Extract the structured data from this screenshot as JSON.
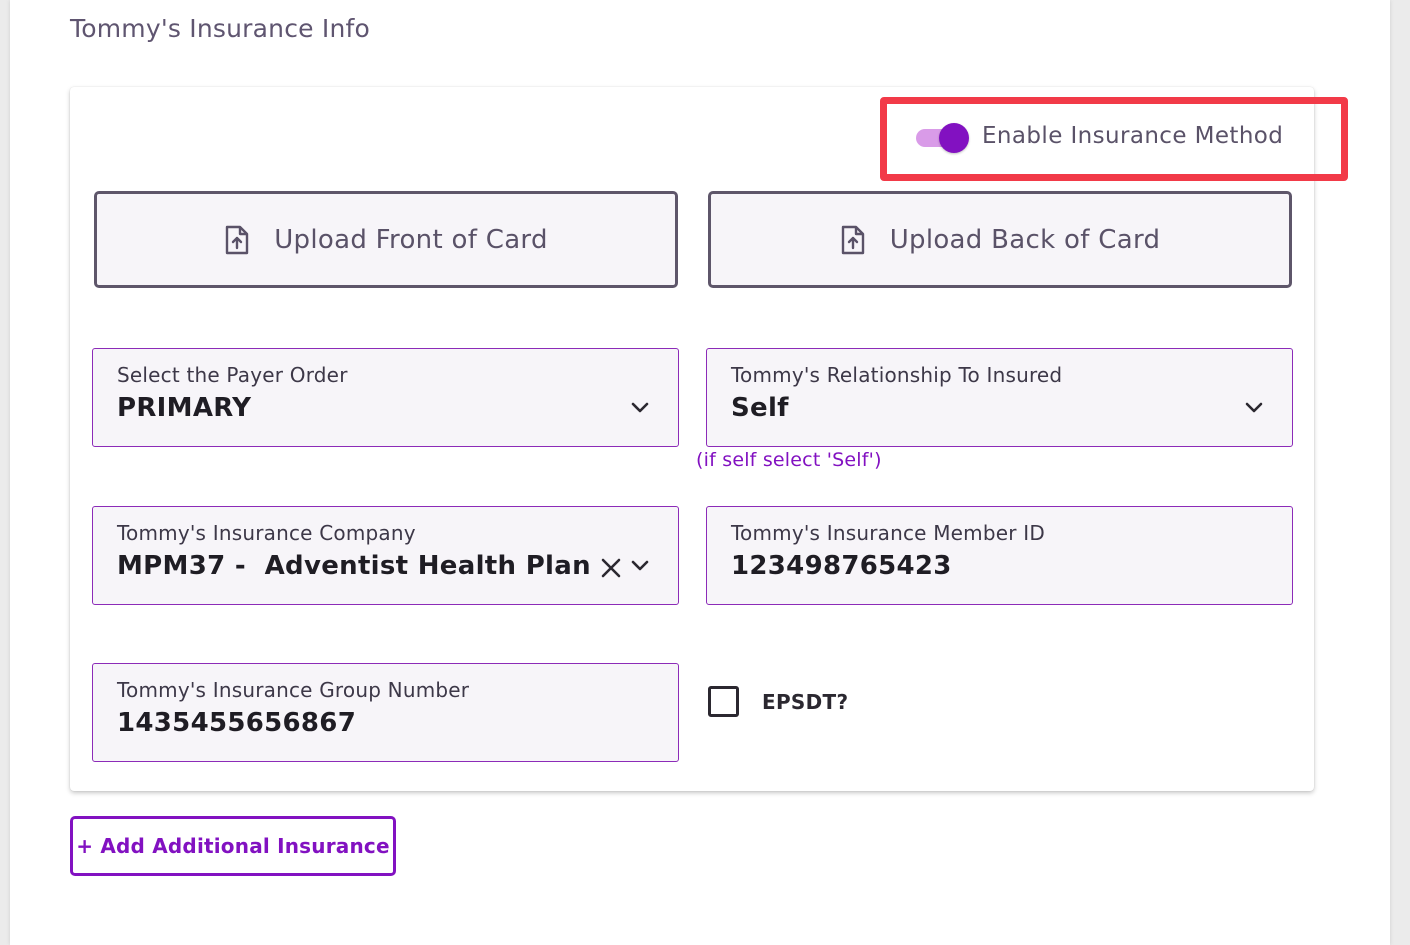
{
  "section": {
    "title": "Tommy's Insurance Info"
  },
  "toggle": {
    "label": "Enable Insurance Method",
    "enabled": true,
    "track_color": "#d99be8",
    "knob_color": "#8211c1"
  },
  "upload": {
    "front_label": "Upload Front of Card",
    "back_label": "Upload Back of Card",
    "icon": "file-upload-icon"
  },
  "fields": {
    "payer_order": {
      "label": "Select the Payer Order",
      "value": "PRIMARY"
    },
    "relationship": {
      "label": "Tommy's Relationship To Insured",
      "value": "Self",
      "helper": "(if self select 'Self')"
    },
    "insurance_company": {
      "label": "Tommy's Insurance Company",
      "value": "MPM37 -  Adventist Health Plan"
    },
    "member_id": {
      "label": "Tommy's Insurance Member ID",
      "value": "123498765423"
    },
    "group_number": {
      "label": "Tommy's Insurance Group Number",
      "value": "1435455656867"
    }
  },
  "epsdt": {
    "label": "EPSDT?",
    "checked": false
  },
  "add_insurance": {
    "label": "+ Add Additional Insurance"
  },
  "colors": {
    "accent": "#8211c1",
    "highlight_border": "#f23a48",
    "field_border": "#8c2bb8",
    "field_bg": "#f7f5f9"
  }
}
